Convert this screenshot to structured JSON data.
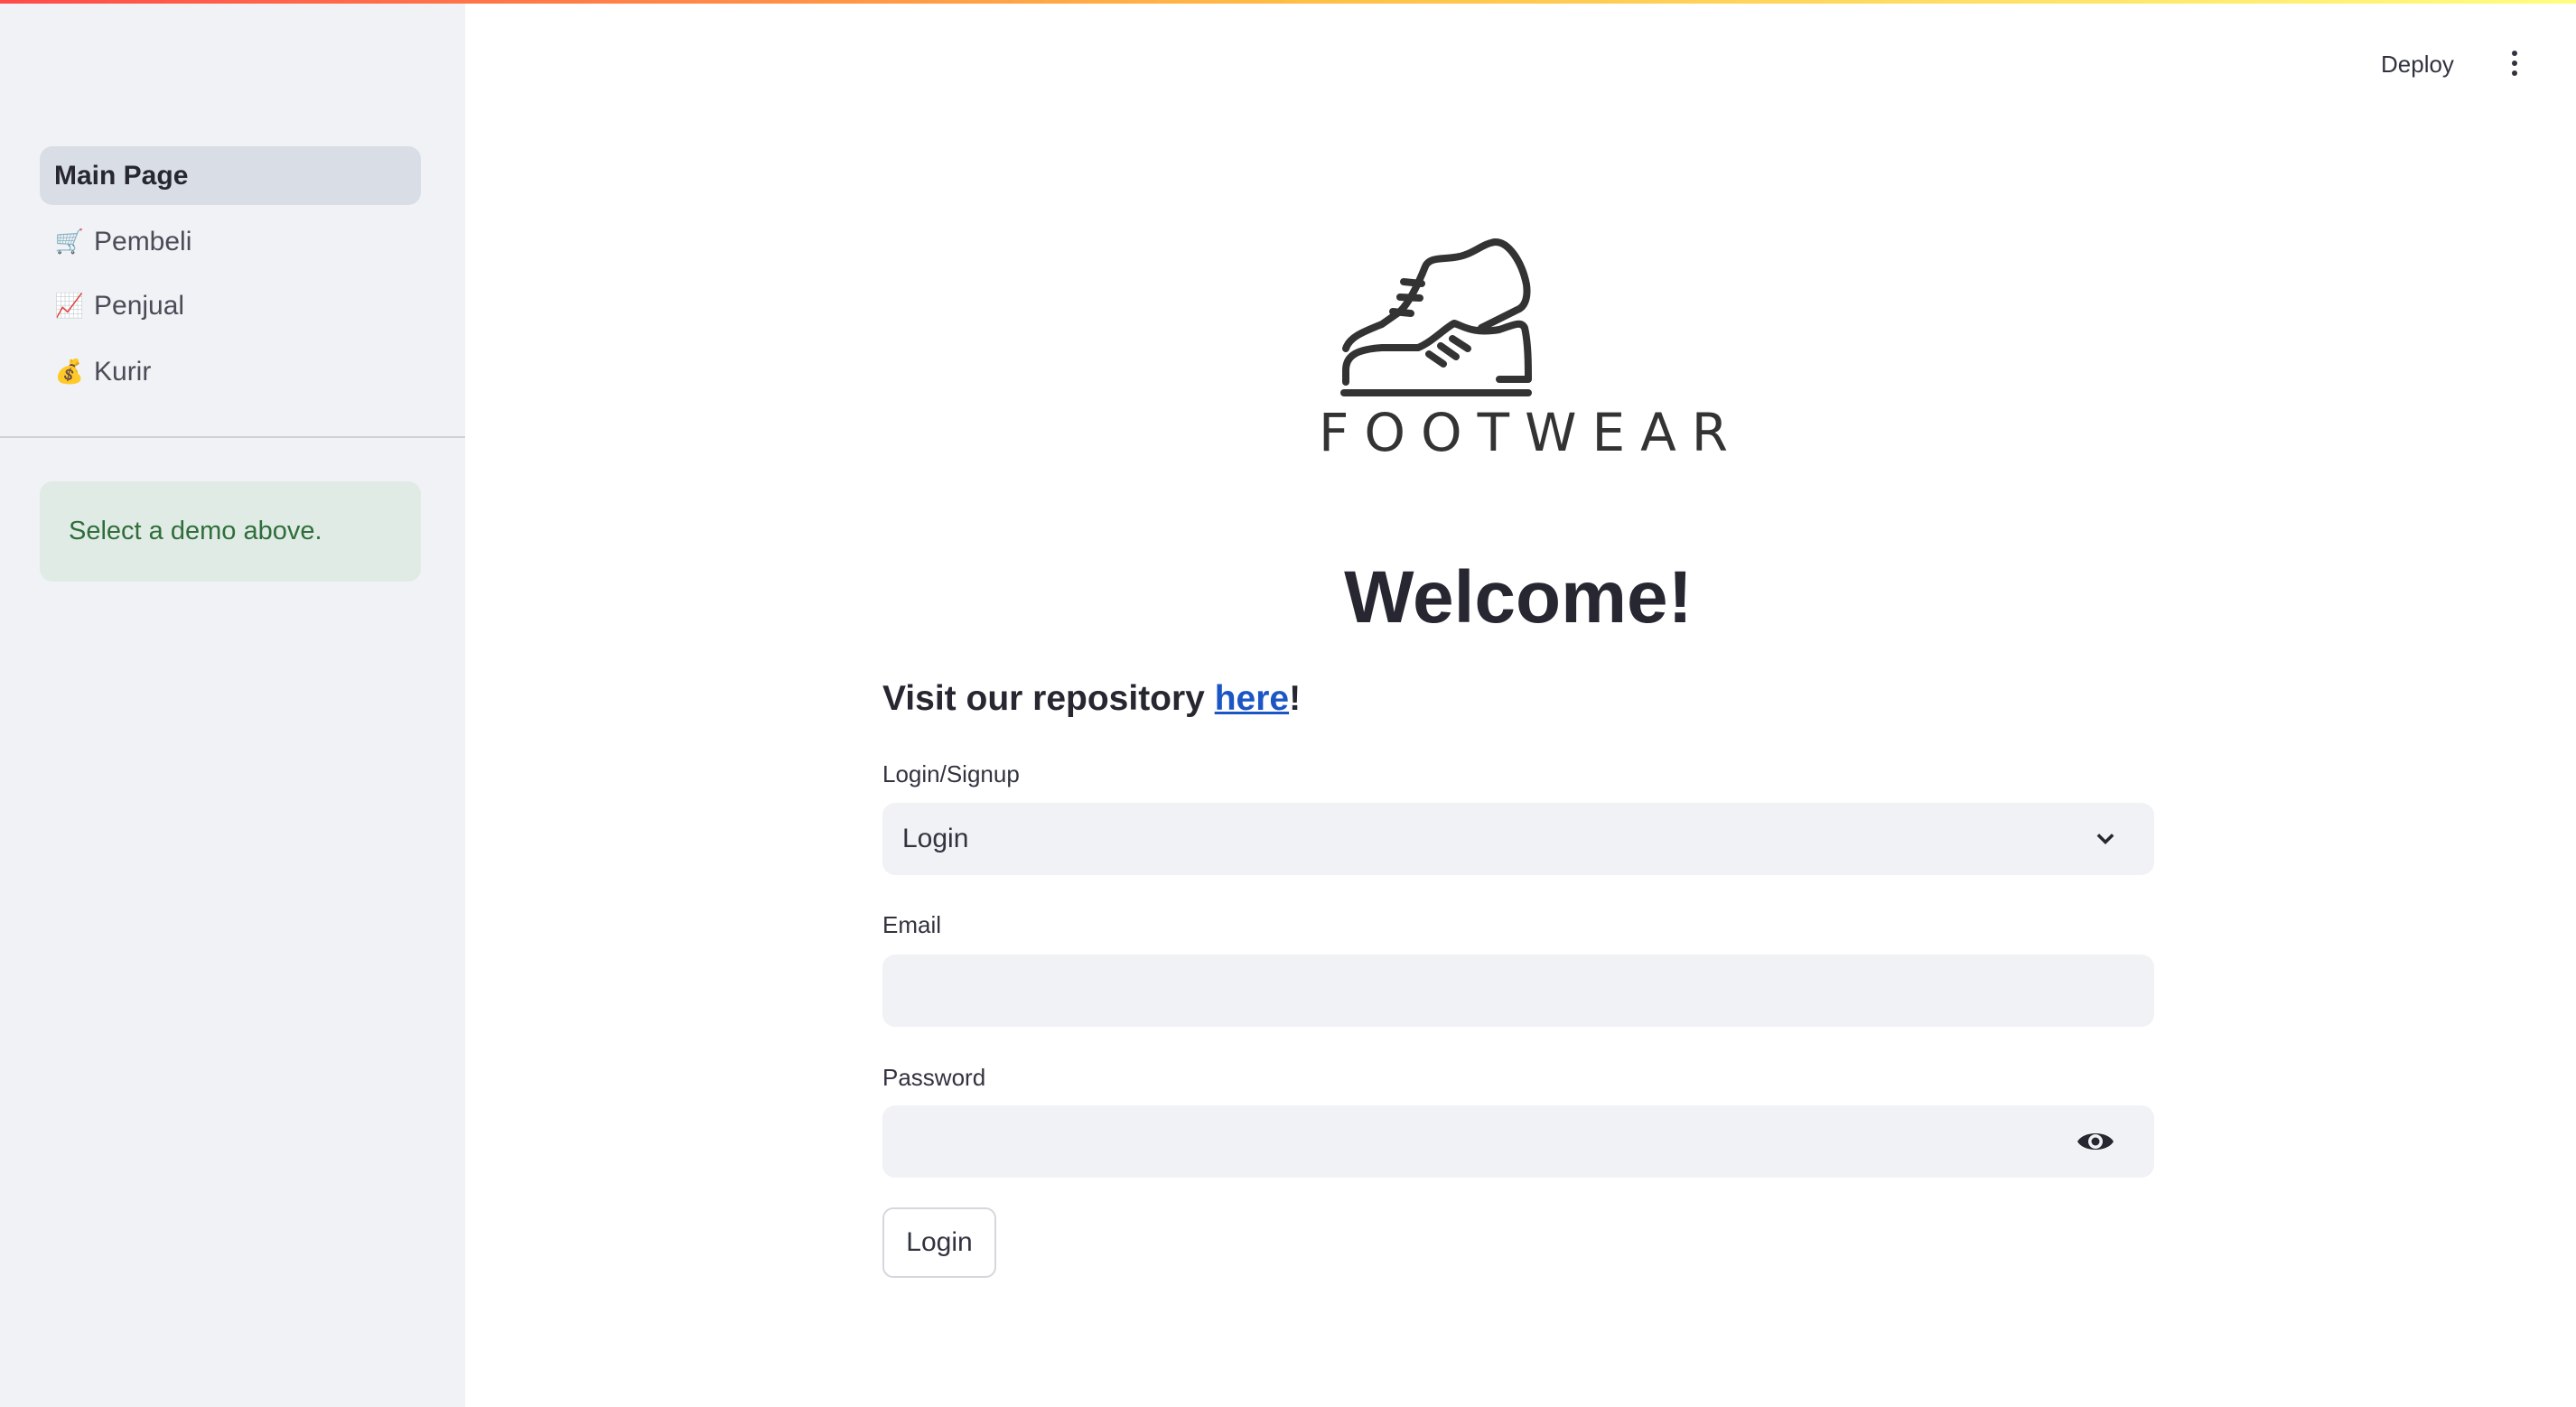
{
  "sidebar": {
    "items": [
      {
        "label": "Main Page",
        "icon": "",
        "active": true
      },
      {
        "label": "Pembeli",
        "icon": "🛒",
        "active": false
      },
      {
        "label": "Penjual",
        "icon": "📈",
        "active": false
      },
      {
        "label": "Kurir",
        "icon": "💰",
        "active": false
      }
    ],
    "info": "Select a demo above."
  },
  "header": {
    "deploy": "Deploy"
  },
  "logo": {
    "text": "FOOTWEAR"
  },
  "main": {
    "title": "Welcome!",
    "visit_prefix": "Visit our repository ",
    "visit_link": "here",
    "visit_suffix": "!",
    "mode_label": "Login/Signup",
    "mode_value": "Login",
    "email_label": "Email",
    "email_value": "",
    "password_label": "Password",
    "password_value": "",
    "submit": "Login"
  }
}
